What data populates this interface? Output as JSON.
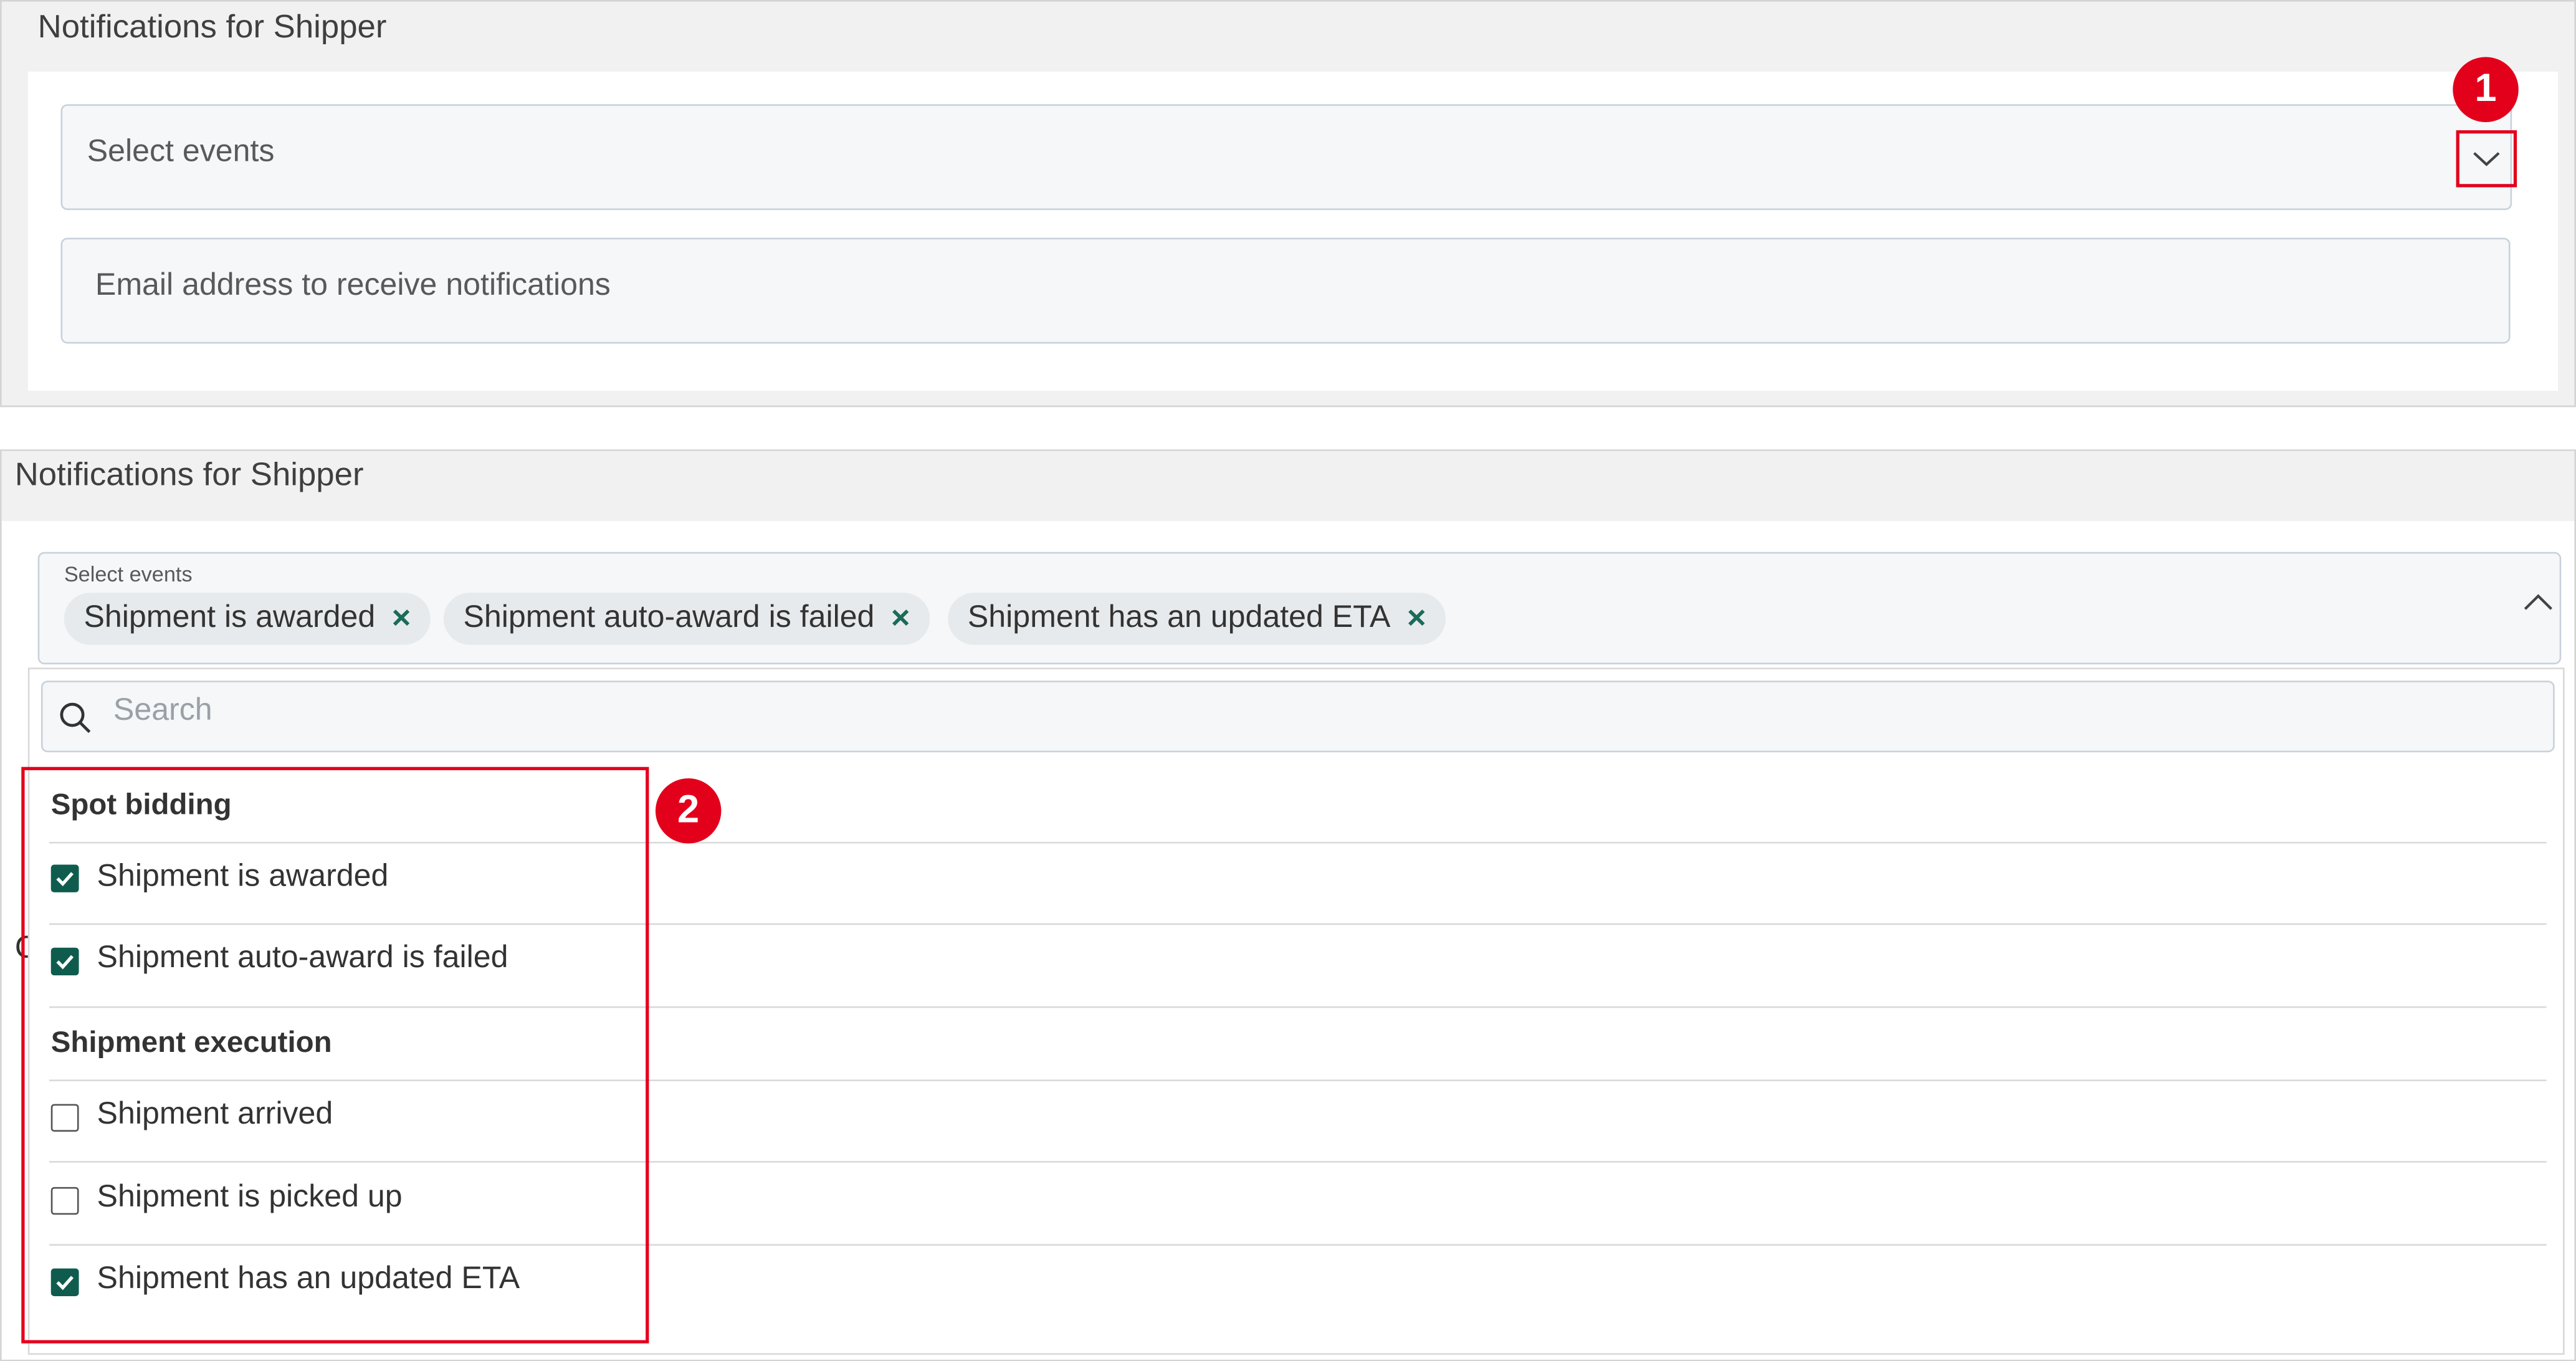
{
  "panel_top": {
    "title": "Notifications for Shipper",
    "select_placeholder": "Select events",
    "email_placeholder": "Email address to receive notifications",
    "callout": "1",
    "expand_icon": "chevron-down-icon"
  },
  "panel_bottom": {
    "title": "Notifications for Shipper",
    "select_label": "Select events",
    "collapse_icon": "chevron-up-icon",
    "chips": [
      {
        "label": "Shipment is awarded",
        "remove": "×"
      },
      {
        "label": "Shipment auto-award is failed",
        "remove": "×"
      },
      {
        "label": "Shipment has an updated ETA",
        "remove": "×"
      }
    ],
    "search_placeholder": "Search",
    "callout": "2",
    "groups": [
      {
        "label": "Spot bidding",
        "options": [
          {
            "label": "Shipment is awarded",
            "checked": true
          },
          {
            "label": "Shipment auto-award is failed",
            "checked": true
          }
        ]
      },
      {
        "label": "Shipment execution",
        "options": [
          {
            "label": "Shipment arrived",
            "checked": false
          },
          {
            "label": "Shipment is picked up",
            "checked": false
          },
          {
            "label": "Shipment has an updated ETA",
            "checked": true
          }
        ]
      }
    ],
    "partial_text": "C"
  },
  "colors": {
    "highlight": "#e3001b",
    "checkbox": "#0f5c4e",
    "chip_close": "#1a6b5a",
    "panel_bg": "#f1f1f1",
    "field_bg": "#f5f7f9"
  }
}
